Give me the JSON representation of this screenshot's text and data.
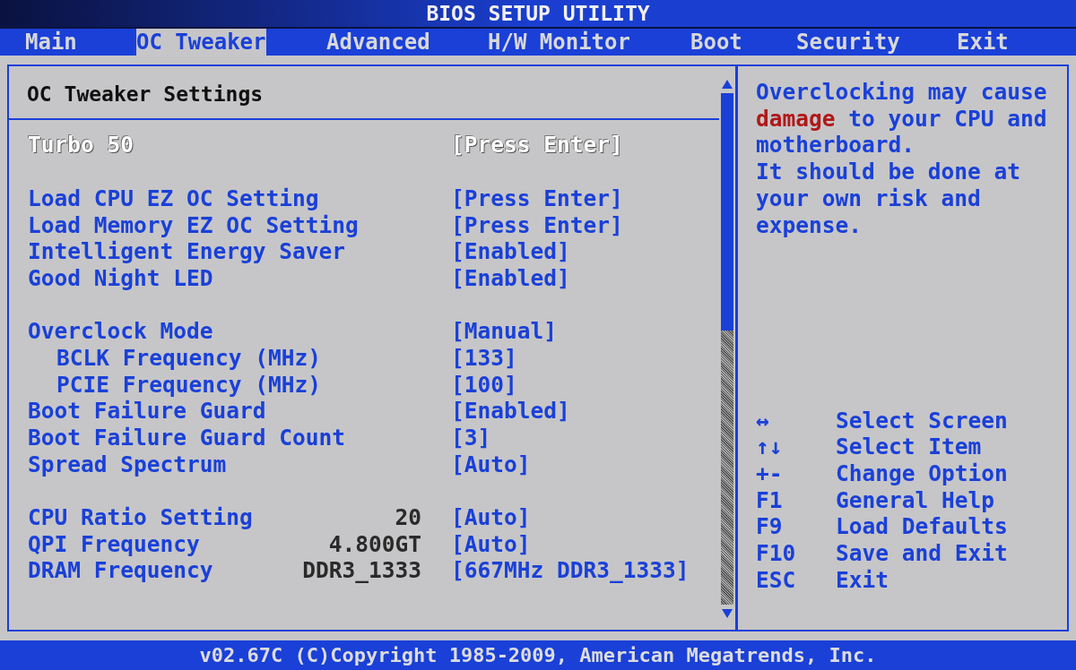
{
  "window": {
    "title": "BIOS SETUP UTILITY"
  },
  "tabs": [
    {
      "label": "Main",
      "selected": false
    },
    {
      "label": "OC Tweaker",
      "selected": true
    },
    {
      "label": "Advanced",
      "selected": false
    },
    {
      "label": "H/W Monitor",
      "selected": false
    },
    {
      "label": "Boot",
      "selected": false
    },
    {
      "label": "Security",
      "selected": false
    },
    {
      "label": "Exit",
      "selected": false
    }
  ],
  "section_title": "OC Tweaker Settings",
  "setting_groups": [
    {
      "settings": [
        {
          "label": "Turbo 50",
          "value": "[Press Enter]",
          "selected": true
        }
      ]
    },
    {
      "settings": [
        {
          "label": "Load CPU EZ OC Setting",
          "value": "[Press Enter]",
          "selected": false
        },
        {
          "label": "Load Memory EZ OC Setting",
          "value": "[Press Enter]",
          "selected": false
        },
        {
          "label": "Intelligent Energy Saver",
          "value": "[Enabled]",
          "selected": false
        },
        {
          "label": "Good Night LED",
          "value": "[Enabled]",
          "selected": false
        }
      ]
    },
    {
      "settings": [
        {
          "label": "Overclock Mode",
          "value": "[Manual]",
          "selected": false,
          "children": [
            {
              "label": "BCLK Frequency (MHz)",
              "value": "[133]",
              "selected": false
            },
            {
              "label": "PCIE Frequency (MHz)",
              "value": "[100]",
              "selected": false
            }
          ]
        },
        {
          "label": "Boot Failure Guard",
          "value": "[Enabled]",
          "selected": false
        },
        {
          "label": "Boot Failure Guard Count",
          "value": "[3]",
          "selected": false
        },
        {
          "label": "Spread Spectrum",
          "value": "[Auto]",
          "selected": false
        }
      ]
    },
    {
      "settings": [
        {
          "label": "CPU Ratio Setting",
          "current": "20",
          "value": "[Auto]",
          "selected": false
        },
        {
          "label": "QPI Frequency",
          "current": "4.800GT",
          "value": "[Auto]",
          "selected": false
        },
        {
          "label": "DRAM Frequency",
          "current": "DDR3_1333",
          "value": "[667MHz DDR3_1333]",
          "selected": false
        }
      ]
    }
  ],
  "help": {
    "parts": [
      {
        "text": "Overclocking may cause ",
        "warning": false
      },
      {
        "text": "damage",
        "warning": true
      },
      {
        "text": " to your CPU and motherboard.",
        "warning": false
      }
    ],
    "note": "It should be done at your own risk and expense."
  },
  "keys": [
    {
      "key": "↔",
      "action": "Select Screen"
    },
    {
      "key": "↑↓",
      "action": "Select Item"
    },
    {
      "key": "+-",
      "action": "Change Option"
    },
    {
      "key": "F1",
      "action": "General Help"
    },
    {
      "key": "F9",
      "action": "Load Defaults"
    },
    {
      "key": "F10",
      "action": "Save and Exit"
    },
    {
      "key": "ESC",
      "action": "Exit"
    }
  ],
  "status_bar": "v02.67C (C)Copyright 1985-2009, American Megatrends, Inc."
}
